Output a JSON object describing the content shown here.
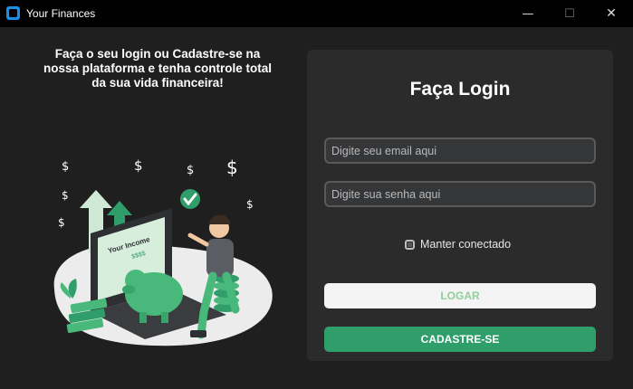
{
  "window": {
    "title": "Your Finances",
    "controls": {
      "minimize": "—",
      "maximize": "☐",
      "close": "✕"
    }
  },
  "left": {
    "tagline": "Faça o seu login ou Cadastre-se na nossa plataforma e tenha controle total da sua vida financeira!",
    "illustration": {
      "screen_title": "Your Income",
      "screen_amount": "$$$$"
    }
  },
  "login": {
    "title": "Faça Login",
    "email_placeholder": "Digite seu email aqui",
    "email_value": "",
    "password_placeholder": "Digite sua senha aqui",
    "password_value": "",
    "remember_label": "Manter conectado",
    "login_button": "LOGAR",
    "signup_button": "CADASTRE-SE"
  },
  "colors": {
    "background": "#1f1f1f",
    "card": "#2b2b2b",
    "accent_green": "#2f9e6a",
    "login_text_green": "#8fcf9d"
  }
}
